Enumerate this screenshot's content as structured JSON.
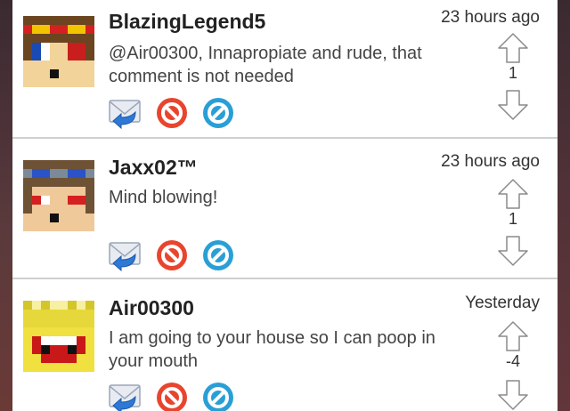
{
  "comments": [
    {
      "username": "BlazingLegend5",
      "time": "23 hours ago",
      "text": "@Air00300, Innapropiate and rude, that comment is not needed",
      "score": "1",
      "avatar_icon": "minecraft-skin-red-goggles"
    },
    {
      "username": "Jaxx02™",
      "time": "23 hours ago",
      "text": "Mind blowing!",
      "score": "1",
      "avatar_icon": "minecraft-skin-blue-goggles"
    },
    {
      "username": "Air00300",
      "time": "Yesterday",
      "text": "I am going to your house so I can poop in your mouth",
      "score": "-4",
      "avatar_icon": "minecraft-skin-yellow-crown"
    }
  ],
  "icons": {
    "reply": "reply-envelope-icon",
    "report": "report-no-icon",
    "block": "block-icon",
    "upvote": "upvote-arrow-icon",
    "downvote": "downvote-arrow-icon"
  },
  "colors": {
    "report_red": "#e8452e",
    "block_blue": "#2a9fd6",
    "separator": "#cfcfcf"
  }
}
